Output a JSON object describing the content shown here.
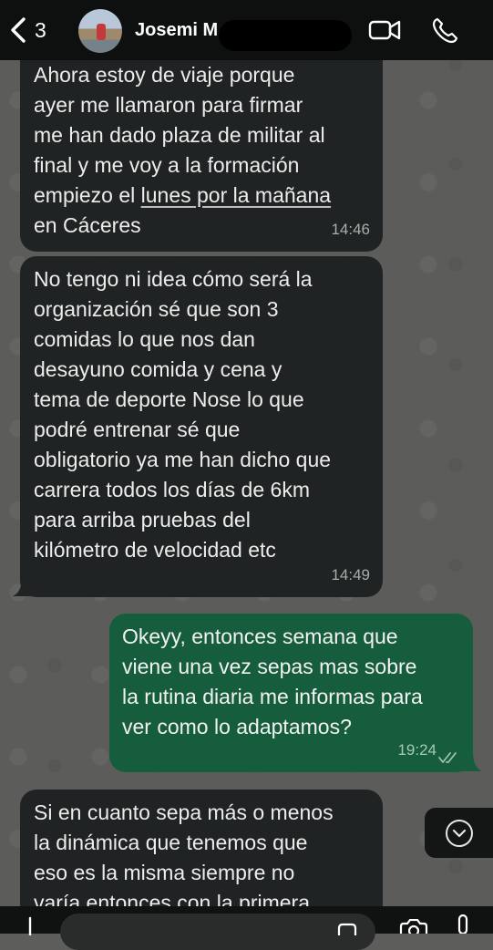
{
  "header": {
    "back_count": "3",
    "contact_name": "Josemi M"
  },
  "messages": [
    {
      "direction": "in",
      "lines": [
        "Ahora estoy de viaje porque",
        "ayer me llamaron para firmar",
        "me han dado plaza de militar al",
        "final y me voy a la formación"
      ],
      "line5_pre": "empiezo el ",
      "line5_link": "lunes por la mañana",
      "line6": "en Cáceres",
      "time": "14:46"
    },
    {
      "direction": "in",
      "lines": [
        "No tengo ni idea cómo será la",
        "organización sé que son 3",
        "comidas lo que nos dan",
        "desayuno comida y cena y",
        "tema de deporte Nose lo que",
        "podré entrenar sé que",
        "obligatorio ya me han dicho que",
        "carrera todos los días de 6km",
        "para arriba pruebas del",
        "kilómetro de velocidad etc"
      ],
      "time": "14:49"
    },
    {
      "direction": "out",
      "lines": [
        "Okeyy, entonces semana que",
        "viene una vez sepas mas sobre",
        "la rutina diaria me informas para",
        "ver como lo adaptamos?"
      ],
      "time": "19:24",
      "status": "read"
    },
    {
      "direction": "in",
      "lines": [
        "Si en cuanto sepa más o menos",
        "la dinámica que tenemos que",
        "eso es la misma siempre no",
        "varía entonces con la primera"
      ]
    }
  ],
  "colors": {
    "incoming_bubble": "#202323",
    "outgoing_bubble": "#155d3c",
    "read_ticks": "#9fc3ad"
  },
  "icons": [
    "back-chevron-icon",
    "video-call-icon",
    "phone-icon",
    "scroll-down-icon",
    "add-icon",
    "sticker-icon",
    "camera-icon",
    "microphone-icon"
  ]
}
